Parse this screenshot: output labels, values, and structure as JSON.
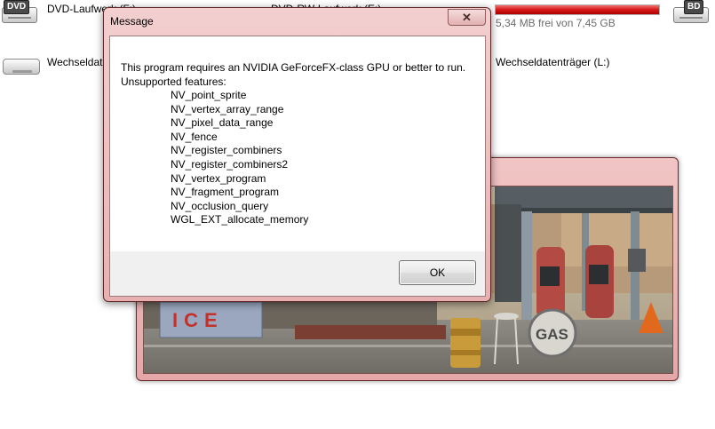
{
  "explorer": {
    "drives": [
      {
        "label": "DVD-Laufwerk (F:)",
        "tag": "DVD",
        "icon": "dvd-drive-icon"
      },
      {
        "label": "DVD-RW-Laufwerk (E:)",
        "icon": "dvd-rw-drive-icon"
      },
      {
        "label": "Wechseldatenträger (K:)",
        "icon": "removable-drive-icon"
      },
      {
        "label": "Wechseldatenträger (L:)",
        "icon": "removable-drive-icon"
      },
      {
        "tag": "BD",
        "icon": "bd-drive-icon"
      }
    ],
    "capacity_text": "5,34 MB frei von 7,45 GB",
    "capacity_used_fraction": 0.999,
    "capacity_color": "#d61818"
  },
  "dialog": {
    "title": "Message",
    "close_symbol": "✕",
    "line1": "This program requires an NVIDIA GeForceFX-class GPU or better to run.",
    "line2": "Unsupported features:",
    "features": [
      "NV_point_sprite",
      "NV_vertex_array_range",
      "NV_pixel_data_range",
      "NV_fence",
      "NV_register_combiners",
      "NV_register_combiners2",
      "NV_vertex_program",
      "NV_fragment_program",
      "NV_occlusion_query",
      "WGL_EXT_allocate_memory"
    ],
    "ok_label": "OK"
  },
  "game": {
    "sign_ice": "ICE",
    "sign_gas": "GAS"
  },
  "colors": {
    "window_frame": "#e8b1b1",
    "client_bg": "#ffffff",
    "button_area_bg": "#f0f0f0"
  }
}
